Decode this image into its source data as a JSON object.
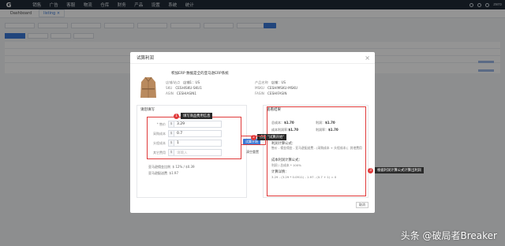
{
  "nav": {
    "logo": "G",
    "items": [
      "销售",
      "广告",
      "客服",
      "物流",
      "仓库",
      "财务",
      "产品",
      "设置",
      "系统",
      "统计"
    ],
    "user": "zero"
  },
  "breadcrumb": {
    "home": "Dashboard",
    "current": "listing",
    "close": "×"
  },
  "modal": {
    "title": "试算利润",
    "close": "×",
    "product": {
      "title": "积加ERP 数据是全的亚马逊ERP系统",
      "fields": [
        {
          "label": "店铺/站点",
          "value": "店铺1：US"
        },
        {
          "label": "SKU",
          "value": "CESHISKU-SKU1"
        },
        {
          "label": "ASIN",
          "value": "CESHIASIN1"
        },
        {
          "label": "产品名称",
          "value": "店铺：US"
        },
        {
          "label": "MSKU",
          "value": "CESHIMSKU-MSKU"
        },
        {
          "label": "FASIN",
          "value": "CESHIFASIN"
        }
      ]
    },
    "left": {
      "title": "请您填写",
      "fields": [
        {
          "label": "* 售价",
          "prefix": "$",
          "value": "3.29",
          "placeholder": ""
        },
        {
          "label": "采购成本",
          "prefix": "$",
          "value": "0.7",
          "placeholder": ""
        },
        {
          "label": "头程成本",
          "prefix": "$",
          "value": "1",
          "placeholder": ""
        },
        {
          "label": "其它费用",
          "prefix": "$",
          "value": "",
          "placeholder": "请输入"
        }
      ],
      "info": [
        {
          "label": "亚马逊佣金比例",
          "value": "$ 12% / $0.39"
        },
        {
          "label": "亚马逊配送费",
          "value": "$1.97"
        }
      ]
    },
    "actions": {
      "calc": "试算开始",
      "reset": "清空重置",
      "cancel": "取消"
    },
    "right": {
      "title": "查看结果",
      "results": [
        {
          "label": "总成本：",
          "value": "$1.70"
        },
        {
          "label": "利润：",
          "value": "$1.70"
        },
        {
          "label": "成本利润率:",
          "value": "$1.70"
        },
        {
          "label": "利润率：",
          "value": "$1.70"
        }
      ],
      "profit_formula_title": "利润计算公式：",
      "profit_formula": "售价 - 佣金佣金 - 亚马逊配送费 - (采购成本 + 头程成本)；其他费用",
      "cost_formula_title": "成本利润计算公式：",
      "cost_formula": "利润 / 总成本 * 100%",
      "calc_title": "计算详情：",
      "calc_detail": "3.29 - (3.29 * 0.0911) - 1.97 - (0.7 + 1) = 0"
    }
  },
  "annotations": {
    "a1_num": "1",
    "a1_text": "填写商品费用信息",
    "a2_num": "2",
    "a2_text": "点击 \"试算开始\"",
    "a3_num": "3",
    "a3_text": "根据利润计算公式计算出利润"
  },
  "watermark": "头条 @破局者Breaker",
  "colors": {
    "nav_bg": "#1f2a36",
    "accent": "#3a78d6",
    "annotation_red": "#e03a3a"
  }
}
